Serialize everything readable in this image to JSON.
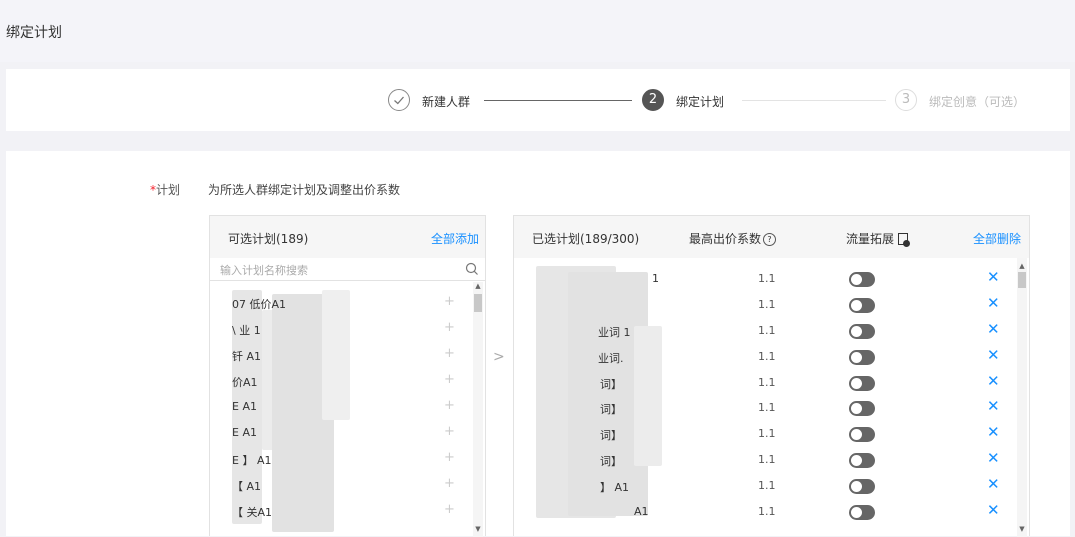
{
  "page": {
    "title": "绑定计划"
  },
  "steps": [
    {
      "number": "✓",
      "label": "新建人群",
      "state": "done"
    },
    {
      "number": "2",
      "label": "绑定计划",
      "state": "active"
    },
    {
      "number": "3",
      "label": "绑定创意（可选）",
      "state": "pending"
    }
  ],
  "form": {
    "required_mark": "*",
    "plan_label": "计划",
    "plan_desc": "为所选人群绑定计划及调整出价系数"
  },
  "left_panel": {
    "title": "可选计划(189)",
    "add_all": "全部添加",
    "search_placeholder": "输入计划名称搜索",
    "items": [
      {
        "text": "07 低价A1",
        "action": "+"
      },
      {
        "text": "\\ 业 1",
        "action": "+"
      },
      {
        "text": "钎 A1",
        "action": "+"
      },
      {
        "text": "价A1",
        "action": "+"
      },
      {
        "text": "E A1",
        "action": "+"
      },
      {
        "text": "E A1",
        "action": "+"
      },
      {
        "text": "E 】 A1",
        "action": "+"
      },
      {
        "text": "【 A1",
        "action": "+"
      },
      {
        "text": "【 关A1",
        "action": "+"
      }
    ]
  },
  "transfer_arrow": ">",
  "right_panel": {
    "title": "已选计划(189/300)",
    "bid_header": "最高出价系数",
    "bid_help": "?",
    "traffic_header": "流量拓展",
    "delete_all": "全部删除",
    "items": [
      {
        "text": "1",
        "bid": "1.1",
        "traffic": false,
        "remove": "✕"
      },
      {
        "text": "",
        "bid": "1.1",
        "traffic": false,
        "remove": "✕"
      },
      {
        "text": "业词 1",
        "bid": "1.1",
        "traffic": false,
        "remove": "✕"
      },
      {
        "text": "业词.",
        "bid": "1.1",
        "traffic": false,
        "remove": "✕"
      },
      {
        "text": "词】",
        "bid": "1.1",
        "traffic": false,
        "remove": "✕"
      },
      {
        "text": "词】",
        "bid": "1.1",
        "traffic": false,
        "remove": "✕"
      },
      {
        "text": "词】",
        "bid": "1.1",
        "traffic": false,
        "remove": "✕"
      },
      {
        "text": "词】",
        "bid": "1.1",
        "traffic": false,
        "remove": "✕"
      },
      {
        "text": "】 A1",
        "bid": "1.1",
        "traffic": false,
        "remove": "✕"
      },
      {
        "text": "A1",
        "bid": "1.1",
        "traffic": false,
        "remove": "✕"
      }
    ]
  },
  "colors": {
    "accent": "#1890ff",
    "required": "#f5222d",
    "active_step": "#555555",
    "toggle_off": "#666666"
  }
}
